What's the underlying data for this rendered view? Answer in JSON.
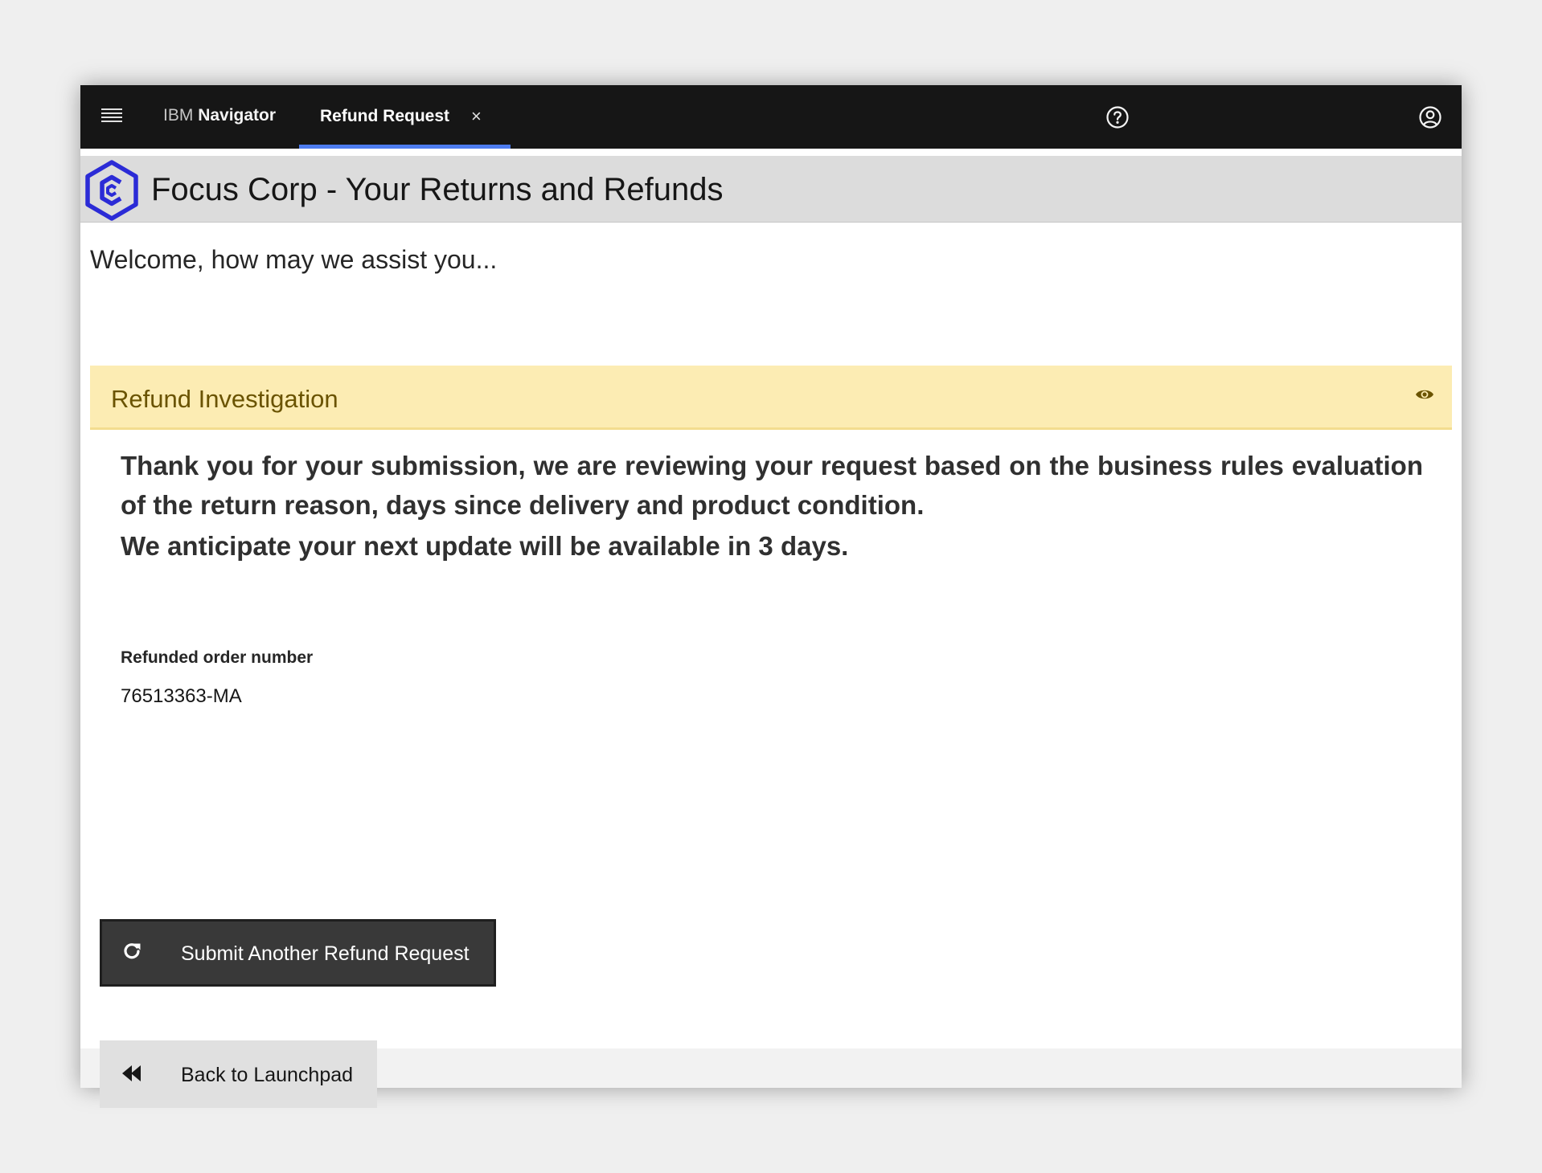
{
  "topbar": {
    "menu_icon": "hamburger-menu-icon",
    "nav_prefix": "IBM",
    "nav_name": "Navigator",
    "active_tab": "Refund Request",
    "close_glyph": "×",
    "help_icon": "help-circle-icon",
    "user_icon": "user-avatar-icon",
    "accent_color": "#4d7cf0"
  },
  "app": {
    "title": "Focus Corp - Your Returns and Refunds",
    "logo_icon": "hexagon-c-logo",
    "logo_color": "#2b2bd6"
  },
  "main": {
    "welcome": "Welcome, how may we assist you...",
    "panel": {
      "title": "Refund Investigation",
      "icon": "eye-icon",
      "background": "#fcecb3"
    },
    "message": "Thank you for your submission, we are reviewing your request based on the business rules evaluation of the return reason, days since delivery and product condition.",
    "anticipate": "We anticipate your next update will be available in 3 days.",
    "order": {
      "label": "Refunded order number",
      "value": "76513363-MA"
    },
    "buttons": {
      "submit_another": "Submit Another Refund Request",
      "submit_icon": "refresh-icon",
      "back": "Back to Launchpad",
      "back_icon": "rewind-icon"
    }
  }
}
